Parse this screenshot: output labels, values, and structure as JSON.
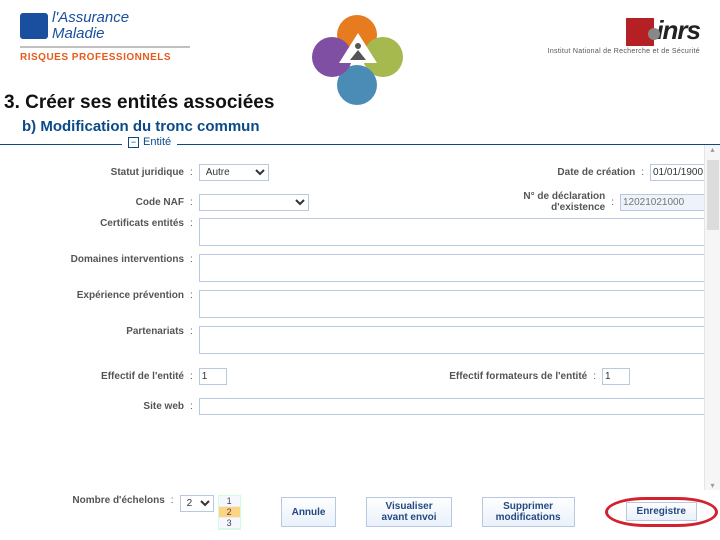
{
  "logos": {
    "assurance_line1": "l'Assurance",
    "assurance_line2": "Maladie",
    "risques": "RISQUES PROFESSIONNELS",
    "inrs": "inrs",
    "inrs_sub": "Institut National de Recherche et de Sécurité"
  },
  "title": {
    "h3": "3.  Créer ses entités associées",
    "hb": "b)    Modification du tronc commun"
  },
  "legend": {
    "icon": "−",
    "text": "Entité"
  },
  "form": {
    "statut_label": "Statut juridique",
    "statut_value": "Autre",
    "date_label": "Date de création",
    "date_value": "01/01/1900",
    "naf_label": "Code NAF",
    "naf_value": "",
    "decl_label": "N° de déclaration d'existence",
    "decl_placeholder": "12021021000",
    "certs_label": "Certificats entités",
    "domaines_label": "Domaines interventions",
    "experience_label": "Expérience prévention",
    "partenariats_label": "Partenariats",
    "effectif_label": "Effectif de l'entité",
    "effectif_value": "1",
    "effectif_form_label": "Effectif formateurs de l'entité",
    "effectif_form_value": "1",
    "site_label": "Site web",
    "echelons_label": "Nombre d'échelons",
    "echelons_value": "2",
    "echelons_options": [
      "1",
      "2",
      "3"
    ]
  },
  "buttons": {
    "annule": "Annule",
    "visualiser": "Visualiser avant envoi",
    "supprimer": "Supprimer modifications",
    "enregistre": "Enregistre"
  }
}
